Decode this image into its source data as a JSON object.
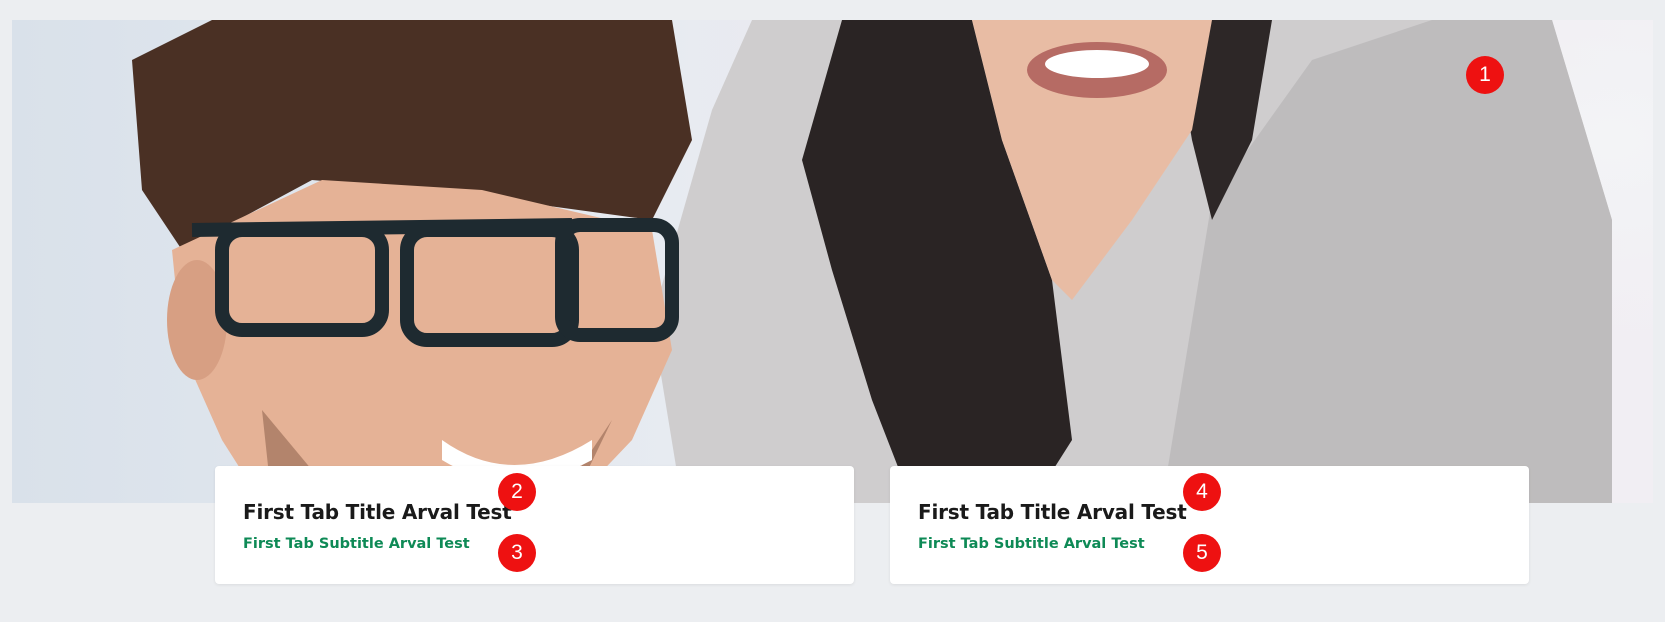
{
  "hero": {
    "image_icon": "people-smiling-photo"
  },
  "cards": [
    {
      "title": "First Tab Title Arval Test",
      "subtitle": "First Tab Subtitle Arval Test"
    },
    {
      "title": "First Tab Title Arval Test",
      "subtitle": "First Tab Subtitle Arval Test"
    }
  ],
  "markers": [
    "1",
    "2",
    "3",
    "4",
    "5"
  ],
  "colors": {
    "subtitle_green": "#0e8a56",
    "marker_red": "#ee1111",
    "page_background": "#eceef1"
  }
}
